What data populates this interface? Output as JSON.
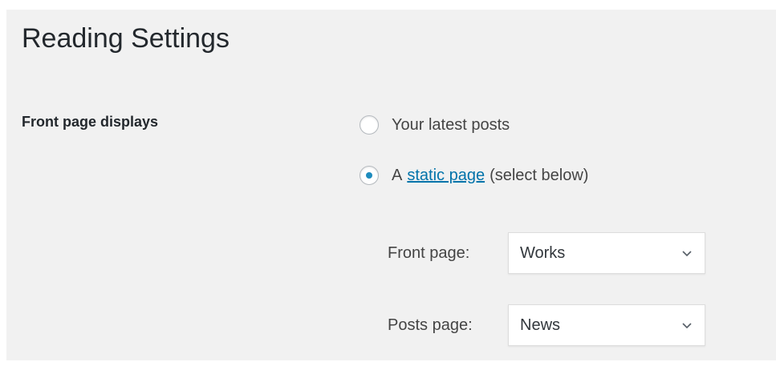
{
  "page": {
    "title": "Reading Settings"
  },
  "front_page_displays": {
    "label": "Front page displays",
    "options": [
      {
        "prefix": "Your latest posts",
        "link": "",
        "suffix": "",
        "selected": false
      },
      {
        "prefix": "A",
        "link": "static page",
        "suffix": "(select below)",
        "selected": true
      }
    ]
  },
  "selects": {
    "front_page": {
      "label": "Front page:",
      "value": "Works"
    },
    "posts_page": {
      "label": "Posts page:",
      "value": "News"
    }
  },
  "colors": {
    "accent": "#0073aa",
    "radio_dot": "#1e8cbe",
    "panel_bg": "#f1f1f1"
  },
  "icons": {
    "dropdown": "chevron-down-icon"
  }
}
